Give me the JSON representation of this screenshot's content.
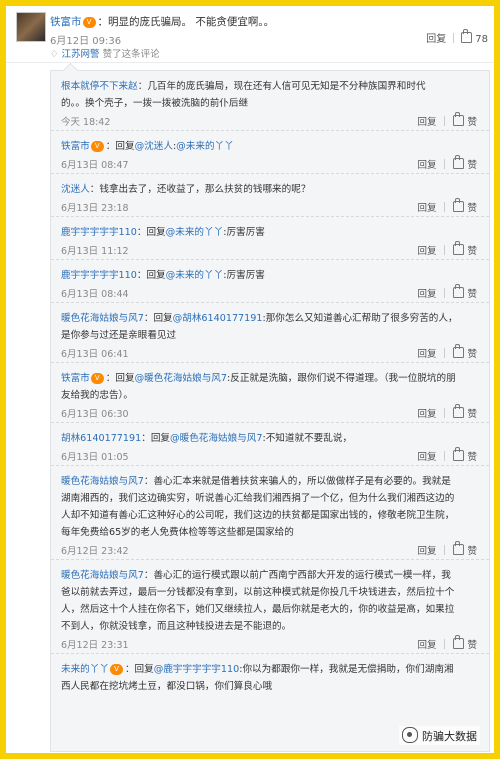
{
  "post": {
    "author": "铁富市",
    "badge": "V",
    "text": "：明显的庞氏骗局。 不能贪便宜啊。。",
    "time": "6月12日 09:36",
    "from_prefix": "",
    "from_link": "江苏网警",
    "from_suffix": "赞了这条评论",
    "reply_label": "回复",
    "like_count": "78"
  },
  "comments": [
    {
      "lines": [
        {
          "user": "根本就停不下来赵",
          "text": "：几百年的庞氏骗局，现在还有人信可见无知是不分种族国界和时代"
        },
        {
          "text": "的。。换个壳子，一拨一拨被洗脑的前仆后继"
        }
      ],
      "time": "今天 18:42",
      "reply": "回复",
      "like": "赞"
    },
    {
      "lines": [
        {
          "user": "铁富市",
          "badge": "V",
          "text": "：回复",
          "at": "@沈迷人",
          "text2": ":",
          "at2": "@未来的丫丫"
        }
      ],
      "time": "6月13日 08:47",
      "reply": "回复",
      "like": "赞"
    },
    {
      "lines": [
        {
          "user": "沈迷人",
          "text": "：钱拿出去了，还收益了，那么扶贫的钱哪来的呢？"
        }
      ],
      "time": "6月13日 23:18",
      "reply": "回复",
      "like": "赞"
    },
    {
      "lines": [
        {
          "user": "鹿宇宇宇宇宇110",
          "text": "：回复",
          "at": "@未来的丫丫",
          "text2": ":厉害厉害"
        }
      ],
      "time": "6月13日 11:12",
      "reply": "回复",
      "like": "赞"
    },
    {
      "lines": [
        {
          "user": "鹿宇宇宇宇宇110",
          "text": "：回复",
          "at": "@未来的丫丫",
          "text2": ":厉害厉害"
        }
      ],
      "time": "6月13日 08:44",
      "reply": "回复",
      "like": "赞"
    },
    {
      "lines": [
        {
          "user": "暖色花海姑娘与风7",
          "text": "：回复",
          "at": "@胡林6140177191",
          "text2": ":那你怎么又知道善心汇帮助了很多穷苦的人，"
        },
        {
          "text": "是你参与过还是亲眼看见过"
        }
      ],
      "time": "6月13日 06:41",
      "reply": "回复",
      "like": "赞"
    },
    {
      "lines": [
        {
          "user": "铁富市",
          "badge": "V",
          "text": "：回复",
          "at": "@暖色花海姑娘与风7",
          "text2": ":反正就是洗脑，跟你们说不得道理。（我一位脱坑的朋"
        },
        {
          "text": "友给我的忠告）。"
        }
      ],
      "time": "6月13日 06:30",
      "reply": "回复",
      "like": "赞"
    },
    {
      "lines": [
        {
          "user": "胡林6140177191",
          "text": "：回复",
          "at": "@暖色花海姑娘与风7",
          "text2": ":不知道就不要乱说，"
        }
      ],
      "time": "6月13日 01:05",
      "reply": "回复",
      "like": "赞"
    },
    {
      "lines": [
        {
          "user": "暖色花海姑娘与风7",
          "text": "：善心汇本来就是借着扶贫来骗人的，所以做做样子是有必要的。我就是"
        },
        {
          "text": "湖南湘西的，我们这边确实穷，听说善心汇给我们湘西捐了一个亿，但为什么我们湘西这边的"
        },
        {
          "text": "人却不知道有善心汇这种好心的公司呢，我们这边的扶贫都是国家出钱的，修敬老院卫生院，"
        },
        {
          "text": "每年免费给65岁的老人免费体检等等这些都是国家给的"
        }
      ],
      "time": "6月12日 23:42",
      "reply": "回复",
      "like": "赞"
    },
    {
      "lines": [
        {
          "user": "暖色花海姑娘与风7",
          "text": "：善心汇的运行模式跟以前广西南宁西部大开发的运行模式一模一样，我"
        },
        {
          "text": "爸以前就去弄过，最后一分钱都没有拿到，以前这种模式就是你投几千块钱进去，然后拉十个"
        },
        {
          "text": "人，然后这十个人挂在你名下，她们又继续拉人，最后你就是老大的，你的收益是高，如果拉"
        },
        {
          "text": "不到人，你就没钱拿，而且这种钱投进去是不能退的。"
        }
      ],
      "time": "6月12日 23:31",
      "reply": "回复",
      "like": "赞"
    },
    {
      "lines": [
        {
          "user": "未来的丫丫",
          "badge": "V",
          "text": "：回复",
          "at": "@鹿宇宇宇宇宇110",
          "text2": ":你以为都跟你一样，我就是无偿捐助，你们湖南湘"
        },
        {
          "text": "西人民都在挖坑烤土豆，都没口锅，你们算良心哦"
        }
      ],
      "time": "",
      "reply": "",
      "like": ""
    }
  ],
  "watermark": "防骗大数据",
  "colors": {
    "border": "#f6d000",
    "link": "#2a6fb8",
    "badge": "#ff8a00",
    "panel": "#f4f5f7"
  }
}
